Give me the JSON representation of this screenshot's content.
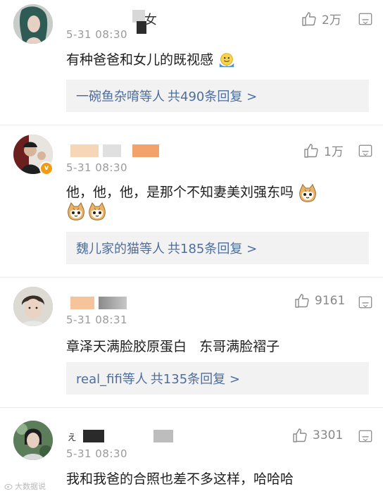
{
  "comments": [
    {
      "name_suffix": "女",
      "time": "5-31 08:30",
      "text": "有种爸爸和女儿的既视感",
      "likes": "2万",
      "reply": {
        "users": "一碗鱼杂唷等人",
        "count": "共490条回复 >"
      }
    },
    {
      "time": "5-31 08:30",
      "text": "他，他，他，是那个不知妻美刘强东吗",
      "likes": "1万",
      "reply": {
        "users": "魏儿家的猫等人",
        "count": "共185条回复 >"
      }
    },
    {
      "time": "5-31 08:31",
      "text": "章泽天满脸胶原蛋白   东哥满脸褶子",
      "likes": "9161",
      "reply": {
        "users": "real_fifi等人",
        "count": "共135条回复 >"
      }
    },
    {
      "name_prefix": "ぇ",
      "time": "5-31 08:30",
      "text": "我和我爸的合照也差不多这样，哈哈哈",
      "likes": "3301"
    }
  ],
  "watermark": "大数据说",
  "icons": {
    "like": "thumbs-up-icon",
    "more": "more-options-icon",
    "emoji_1": "emoji-hug-icon",
    "emoji_2": "emoji-cat-icon",
    "verified": "verified-badge-icon"
  },
  "colors": {
    "link": "#4e6e9e",
    "reply_bg": "#f2f2f2",
    "meta": "#9a9a9a",
    "badge": "#f39c12"
  }
}
